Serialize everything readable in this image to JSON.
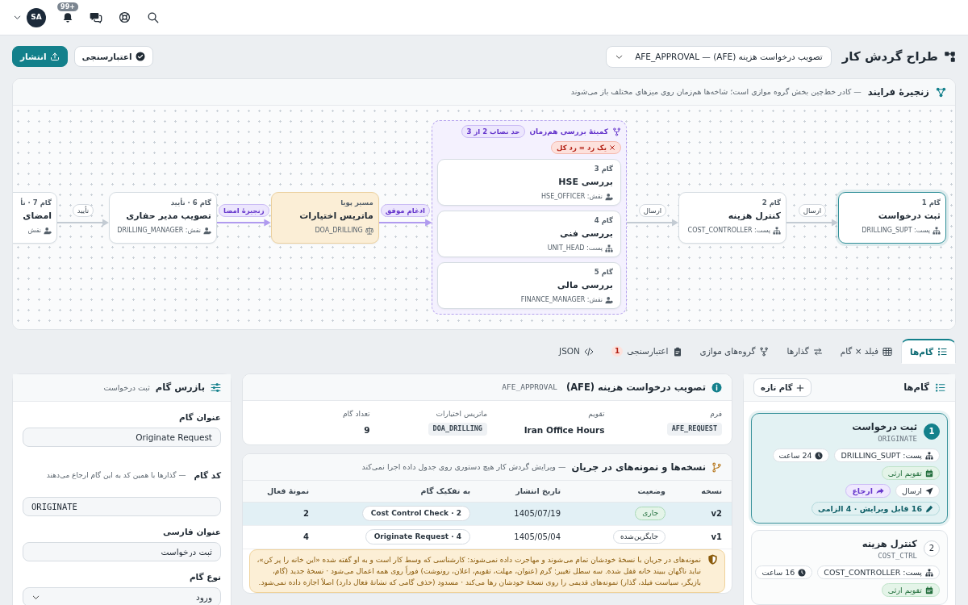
{
  "topbar": {
    "notification_count": "99+",
    "avatar": "SA"
  },
  "header": {
    "title": "طراح گردش کار",
    "workflow_select": "تصویب درخواست هزینه (AFE) — AFE_APPROVAL",
    "validate_button": "اعتبارسنجی",
    "publish_button": "انتشار"
  },
  "process_chain": {
    "title": "زنجیرهٔ فرایند",
    "subtitle": "— کادر خط‌چین بخش گروه موازی است؛ شاخه‌ها هم‌زمان روی میزهای مختلف باز می‌شوند",
    "items": [
      {
        "kind": "step",
        "caption": "گام 1",
        "title": "ثبت درخواست",
        "actor": {
          "kind": "position",
          "text": "پست: DRILLING_SUPT"
        },
        "selected": true
      },
      {
        "kind": "edge",
        "accent": false,
        "label": "ارسال"
      },
      {
        "kind": "step",
        "caption": "گام 2",
        "title": "کنترل هزینه",
        "actor": {
          "kind": "position",
          "text": "پست: COST_CONTROLLER"
        },
        "selected": false
      },
      {
        "kind": "edge",
        "accent": false,
        "label": "ارسال"
      },
      {
        "kind": "group",
        "title": "کمیتهٔ بررسی هم‌زمان",
        "quorum": "حد نصاب 2 از 3",
        "veto": "یک رد = رد کل",
        "steps": [
          {
            "caption": "گام 3",
            "title": "بررسی HSE",
            "actor": {
              "kind": "role",
              "text": "نقش: HSE_OFFICER"
            },
            "selected": false
          },
          {
            "caption": "گام 4",
            "title": "بررسی فنی",
            "actor": {
              "kind": "position",
              "text": "پست: UNIT_HEAD"
            },
            "selected": false
          },
          {
            "caption": "گام 5",
            "title": "بررسی مالی",
            "actor": {
              "kind": "role",
              "text": "نقش: FINANCE_MANAGER"
            },
            "selected": false
          }
        ]
      },
      {
        "kind": "edge",
        "accent": true,
        "label": "ادغام موفق"
      },
      {
        "kind": "dynamic",
        "caption": "مسیر پویا",
        "title": "ماتریس اختیارات",
        "actor": {
          "kind": "matrix",
          "text": "DOA_DRILLING"
        },
        "selected": false
      },
      {
        "kind": "edge",
        "accent": true,
        "label": "زنجیرهٔ امضا"
      },
      {
        "kind": "step",
        "caption": "گام 6 · تأیید",
        "title": "تصویب مدیر حفاری",
        "actor": {
          "kind": "role",
          "text": "نقش: DRILLING_MANAGER"
        },
        "selected": false
      },
      {
        "kind": "edge",
        "accent": false,
        "label": "تأیید"
      },
      {
        "kind": "step",
        "caption": "گام 7 · تأ",
        "title": "امضای",
        "actor": {
          "kind": "role",
          "text": "نقش"
        },
        "selected": false
      }
    ]
  },
  "tabs": [
    {
      "label": "گام‌ها",
      "selected": true
    },
    {
      "label": "فیلد × گام",
      "selected": false
    },
    {
      "label": "گذارها",
      "selected": false
    },
    {
      "label": "گروه‌های موازی",
      "selected": false
    },
    {
      "label": "اعتبارسنجی",
      "selected": false,
      "badge": "1"
    },
    {
      "label": "JSON",
      "selected": false
    }
  ],
  "steps_panel": {
    "title": "گام‌ها",
    "add_button": "گام تازه",
    "steps": [
      {
        "number": "1",
        "title": "ثبت درخواست",
        "code": "ORIGINATE",
        "selected": true,
        "chip_rows": [
          {
            "chips": [
              {
                "kind": "position",
                "text": "پست: DRILLING_SUPT"
              },
              {
                "kind": "sla",
                "text": "24 ساعت"
              }
            ]
          },
          {
            "chips": [
              {
                "kind": "calendar",
                "text": "تقویم ارثی"
              }
            ]
          },
          {
            "chips": [
              {
                "kind": "action",
                "text": "ارسال"
              },
              {
                "kind": "referral",
                "text": "ارجاع"
              }
            ]
          },
          {
            "chips": [
              {
                "kind": "fields",
                "text": "16 قابل ویرایش · 4 الزامی"
              }
            ]
          }
        ]
      },
      {
        "number": "2",
        "title": "کنترل هزینه",
        "code": "COST_CTRL",
        "selected": false,
        "chip_rows": [
          {
            "chips": [
              {
                "kind": "position",
                "text": "پست: COST_CONTROLLER"
              },
              {
                "kind": "sla",
                "text": "16 ساعت"
              }
            ]
          },
          {
            "chips": [
              {
                "kind": "calendar",
                "text": "تقویم ارثی"
              }
            ]
          }
        ]
      }
    ]
  },
  "workflow_info": {
    "title": "تصویب درخواست هزینه (AFE)",
    "code": "AFE_APPROVAL",
    "fields": [
      {
        "label": "فرم",
        "value": "AFE_REQUEST",
        "kind": "code"
      },
      {
        "label": "تقویم",
        "value": "Iran Office Hours",
        "kind": "text"
      },
      {
        "label": "ماتریس اختیارات",
        "value": "DOA_DRILLING",
        "kind": "code"
      },
      {
        "label": "تعداد گام",
        "value": "9",
        "kind": "text"
      }
    ]
  },
  "versions": {
    "title": "نسخه‌ها و نمونه‌های در جریان",
    "subtitle": "— ویرایش گردش کار هیچ دستوری روی جدول داده اجرا نمی‌کند",
    "columns": [
      "نسخه",
      "وضعیت",
      "تاریخ انتشار",
      "به تفکیک گام",
      "نمونهٔ فعال"
    ],
    "rows": [
      {
        "version": "v2",
        "status": {
          "kind": "current",
          "text": "جاری"
        },
        "published": "1405/07/19",
        "breakdown": "Cost Control Check · 2",
        "active": "2",
        "selected": true
      },
      {
        "version": "v1",
        "status": {
          "kind": "superseded",
          "text": "جایگزین‌شده"
        },
        "published": "1405/05/04",
        "breakdown": "Originate Request · 4",
        "active": "4",
        "selected": false
      }
    ],
    "notice": "نمونه‌های در جریان با نسخهٔ خودشان تمام می‌شوند و مهاجرت داده نمی‌شوند: کارشناسی که وسط کار است و به او گفته شده «این خانه را پر کن»، نباید ناگهان ببیند خانه قفل شده. سه سطل تغییر: گرم (عنوان، مهلت، تقویم، اعلان، رونوشت) فوراً روی همه اعمال می‌شود · نسخهٔ جدید (گام، بازیگر، سیاست فیلد، گذار) نمونه‌های قدیمی را روی نسخهٔ خودشان رها می‌کند · مسدود (حذف گامی که نشانهٔ فعال دارد) اصلاً اجازه داده نمی‌شود."
  },
  "inspector": {
    "title": "بازرس گام",
    "subtitle": "ثبت درخواست",
    "fields": [
      {
        "label": "عنوان گام",
        "value": "Originate Request",
        "kind": "text"
      },
      {
        "label": "کد گام",
        "hint": "— گذارها با همین کد به این گام ارجاع می‌دهند",
        "value": "ORIGINATE",
        "kind": "code"
      },
      {
        "label": "عنوان فارسی",
        "value": "ثبت درخواست",
        "kind": "text"
      },
      {
        "label": "نوع گام",
        "value": "ورود",
        "kind": "select"
      }
    ]
  }
}
